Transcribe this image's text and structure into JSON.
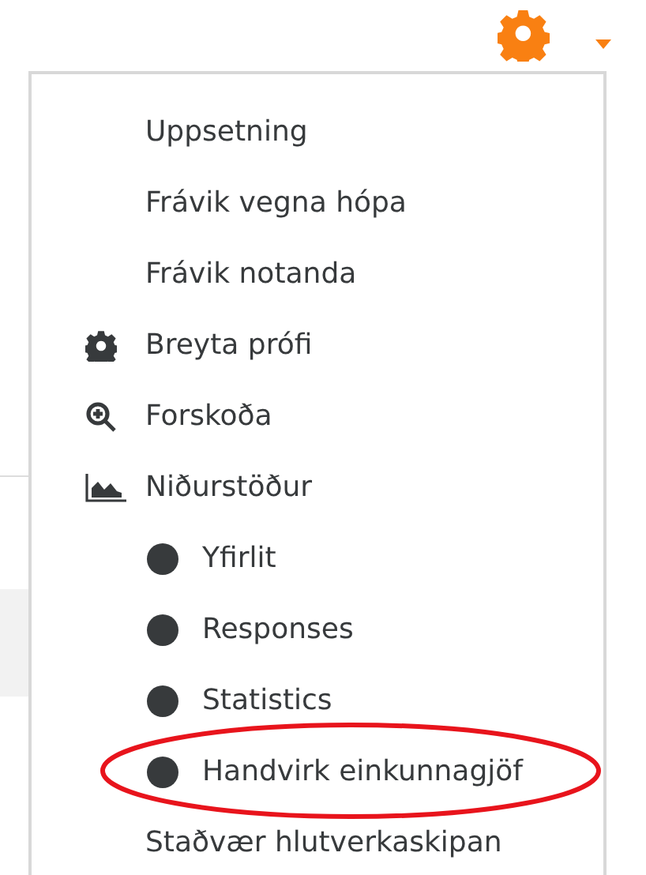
{
  "menu": {
    "items": [
      {
        "kind": "plain",
        "label": "Uppsetning",
        "circled": false
      },
      {
        "kind": "plain",
        "label": "Frávik vegna hópa",
        "circled": false
      },
      {
        "kind": "plain",
        "label": "Frávik notanda",
        "circled": false
      },
      {
        "kind": "gear",
        "label": "Breyta prófi",
        "circled": false
      },
      {
        "kind": "zoom",
        "label": "Forskoða",
        "circled": false
      },
      {
        "kind": "chart",
        "label": "Niðurstöður",
        "circled": false,
        "children": [
          {
            "kind": "bullet",
            "label": "Yfirlit",
            "circled": false
          },
          {
            "kind": "bullet",
            "label": "Responses",
            "circled": false
          },
          {
            "kind": "bullet",
            "label": "Statistics",
            "circled": false
          },
          {
            "kind": "bullet",
            "label": "Handvirk einkunnagjöf",
            "circled": true
          }
        ]
      },
      {
        "kind": "plain",
        "label": "Staðvær hlutverkaskipan",
        "circled": false
      }
    ]
  }
}
